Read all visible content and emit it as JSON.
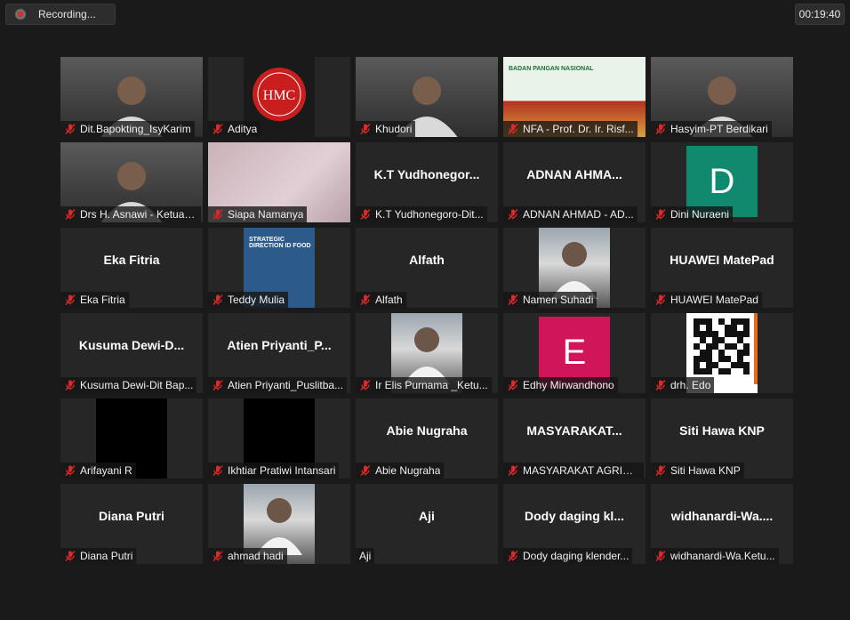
{
  "recording": {
    "label": "Recording..."
  },
  "timer": "00:19:40",
  "colors": {
    "active_speaker_border": "#d8e25a",
    "mute": "#e02828",
    "avatar_d": "#0f8a6e",
    "avatar_e": "#d0155a"
  },
  "tiles": [
    {
      "big": "",
      "name": "Dit.Bapokting_IsyKarim",
      "type": "video",
      "icon": "video-feed"
    },
    {
      "big": "",
      "name": "Aditya",
      "type": "video",
      "icon": "hmc-logo",
      "logo_text": "HMC"
    },
    {
      "big": "",
      "name": "Khudori",
      "type": "video",
      "icon": "video-feed"
    },
    {
      "big": "",
      "name": "NFA - Prof. Dr. Ir. Risf...",
      "type": "video",
      "icon": "slide-feed",
      "slide_text": "BADAN PANGAN NASIONAL"
    },
    {
      "big": "",
      "name": "Hasyim-PT Berdikari",
      "type": "video",
      "icon": "video-feed"
    },
    {
      "big": "",
      "name": "Drs H. Asnawi - Ketua U...",
      "type": "video",
      "icon": "video-feed"
    },
    {
      "big": "",
      "name": "Siapa Namanya",
      "type": "video",
      "icon": "blurred-feed"
    },
    {
      "big": "K.T Yudhonegor...",
      "name": "K.T Yudhonegoro-Dit...",
      "type": "text"
    },
    {
      "big": "ADNAN AHMA...",
      "name": "ADNAN AHMAD - AD...",
      "type": "text"
    },
    {
      "big": "",
      "name": "Dini Nuraeni",
      "type": "avatar",
      "letter": "D",
      "color": "#0f8a6e"
    },
    {
      "big": "Eka Fitria",
      "name": "Eka Fitria",
      "type": "text"
    },
    {
      "big": "",
      "name": "Teddy Mulia",
      "type": "video",
      "icon": "slide-feed",
      "slide_text": "STRATEGIC DIRECTION ID FOOD"
    },
    {
      "big": "Alfath",
      "name": "Alfath",
      "type": "text"
    },
    {
      "big": "",
      "name": "Namen Suhadi",
      "type": "video",
      "icon": "photo-feed"
    },
    {
      "big": "HUAWEI MatePad",
      "name": "HUAWEI MatePad",
      "type": "text"
    },
    {
      "big": "Kusuma Dewi-D...",
      "name": "Kusuma Dewi-Dit Bap...",
      "type": "text"
    },
    {
      "big": "Atien Priyanti_P...",
      "name": "Atien Priyanti_Puslitba...",
      "type": "text"
    },
    {
      "big": "",
      "name": "Ir Elis Purnama _Ketu...",
      "type": "video",
      "icon": "photo-feed"
    },
    {
      "big": "",
      "name": "Edhy Mirwandhono",
      "type": "avatar",
      "letter": "E",
      "color": "#d0155a"
    },
    {
      "big": "",
      "name": "drh. Edo",
      "type": "video",
      "icon": "qr-code"
    },
    {
      "big": "",
      "name": "Arifayani R",
      "type": "video",
      "icon": "black-feed"
    },
    {
      "big": "",
      "name": "Ikhtiar Pratiwi Intansari",
      "type": "video",
      "icon": "black-feed"
    },
    {
      "big": "Abie Nugraha",
      "name": "Abie Nugraha",
      "type": "text"
    },
    {
      "big": "MASYARAKAT...",
      "name": "MASYARAKAT AGRIBI...",
      "type": "text"
    },
    {
      "big": "Siti Hawa KNP",
      "name": "Siti Hawa KNP",
      "type": "text"
    },
    {
      "big": "Diana Putri",
      "name": "Diana Putri",
      "type": "text"
    },
    {
      "big": "",
      "name": "ahmad hadi",
      "type": "video",
      "icon": "photo-feed"
    },
    {
      "big": "Aji",
      "name": "Aji",
      "type": "text",
      "unmuted": true
    },
    {
      "big": "Dody daging kl...",
      "name": "Dody daging klender...",
      "type": "text"
    },
    {
      "big": "widhanardi-Wa....",
      "name": "widhanardi-Wa.Ketu...",
      "type": "text"
    }
  ]
}
